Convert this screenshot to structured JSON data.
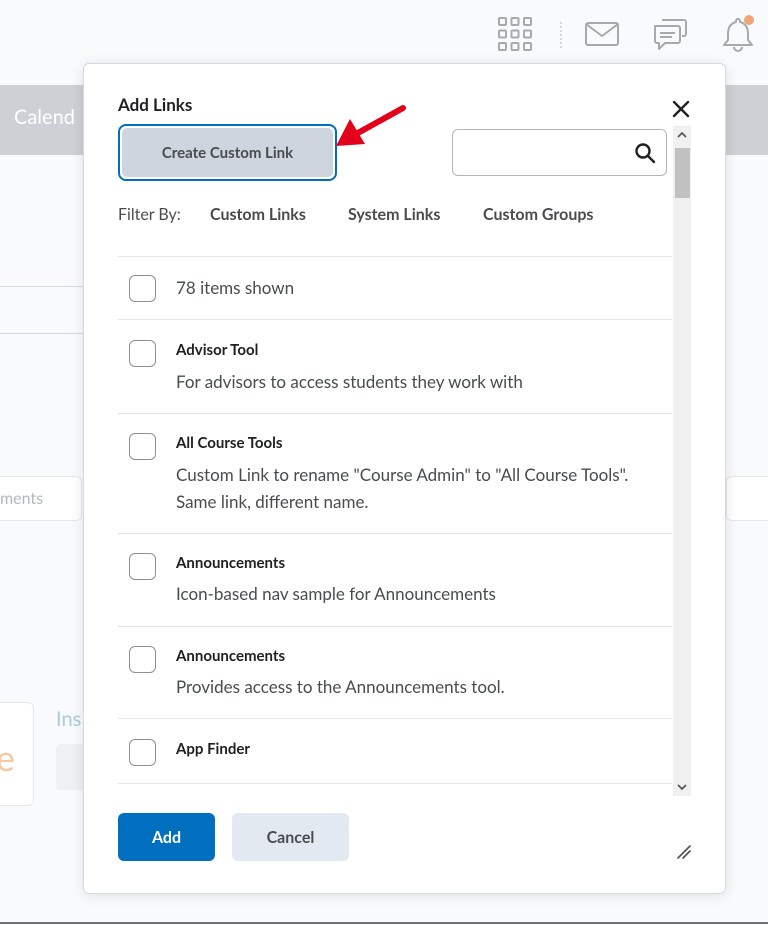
{
  "background": {
    "nav_label": "Calend",
    "field_text": "ments",
    "card_letter": "e",
    "ins_text": "Ins"
  },
  "icons": {
    "apps": "apps-grid-icon",
    "mail": "mail-icon",
    "chat": "chat-icon",
    "bell": "bell-icon",
    "close": "close-icon",
    "search": "search-icon",
    "arrow": "red-arrow-annotation",
    "resize": "resize-handle-icon"
  },
  "colors": {
    "primary": "#006fbf",
    "arrow": "#e2001a",
    "notification": "#f3a477"
  },
  "dialog": {
    "title": "Add Links",
    "create_custom_link": "Create Custom Link",
    "search_placeholder": "",
    "filter_label": "Filter By:",
    "filters": [
      "Custom Links",
      "System Links",
      "Custom Groups"
    ],
    "items_shown": "78 items shown",
    "items": [
      {
        "title": "Advisor Tool",
        "description": "For advisors to access students they work with"
      },
      {
        "title": "All Course Tools",
        "description": "Custom Link to rename \"Course Admin\" to \"All Course Tools\". Same link, different name."
      },
      {
        "title": "Announcements",
        "description": "Icon-based nav sample for Announcements"
      },
      {
        "title": "Announcements",
        "description": "Provides access to the Announcements tool."
      },
      {
        "title": "App Finder",
        "description": ""
      }
    ],
    "add_label": "Add",
    "cancel_label": "Cancel"
  }
}
